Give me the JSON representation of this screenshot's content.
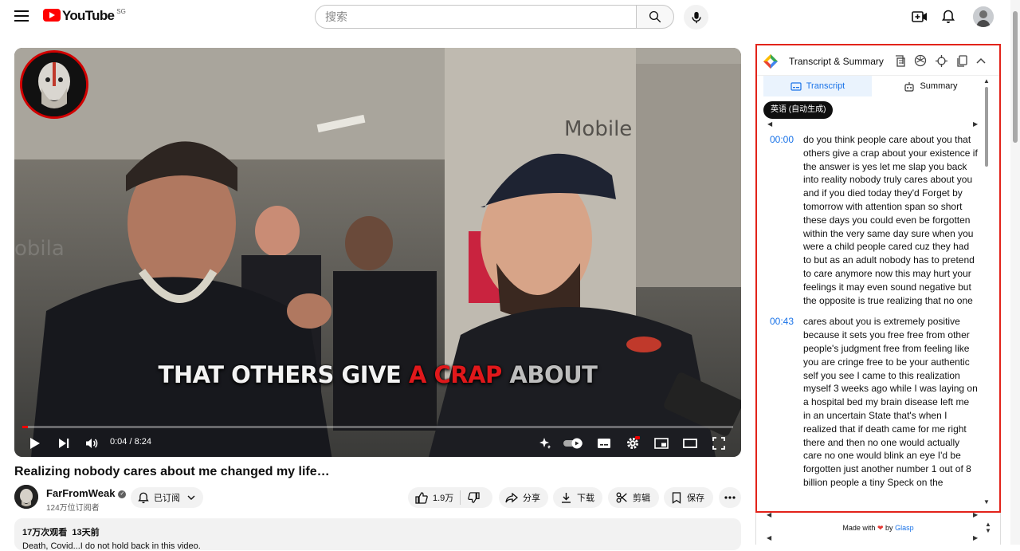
{
  "masthead": {
    "logo_text": "YouTube",
    "region": "SG",
    "search_placeholder": "搜索"
  },
  "player": {
    "caption": {
      "part1": "THAT OTHERS GIVE ",
      "part2": "A CRAP",
      "part3": " ABOUT"
    },
    "time": "0:04 / 8:24",
    "progress": 0.008
  },
  "video": {
    "title": "Realizing nobody cares about me changed my life…",
    "channel": "FarFromWeak",
    "subscribers": "124万位订阅者",
    "subscribe_label": "已订阅",
    "like_count": "1.9万",
    "share_label": "分享",
    "download_label": "下载",
    "clip_label": "剪辑",
    "save_label": "保存",
    "views": "17万次观看",
    "date": "13天前",
    "description": "Death, Covid...I do not hold back in this video."
  },
  "glasp": {
    "title": "Transcript & Summary",
    "tabs": [
      "Transcript",
      "Summary"
    ],
    "language": "英语 (自动生成)",
    "segments": [
      {
        "time": "00:00",
        "text": "do you think people care about you that others give a crap about your existence if the answer is yes let me slap you back into reality nobody truly cares about you and if you died today they'd Forget by tomorrow with attention span so short these days you could even be forgotten within the very same day sure when you were a child people cared cuz they had to but as an adult nobody has to pretend to care anymore now this may hurt your feelings it may even sound negative but the opposite is true realizing that no one"
      },
      {
        "time": "00:43",
        "text": "cares about you is extremely positive because it sets you free free from other people's judgment free from feeling like you are cringe free to be your authentic self you see I came to this realization myself 3 weeks ago while I was laying on a hospital bed my brain disease left me in an uncertain State that's when I realized that if death came for me right there and then no one would actually care no one would blink an eye I'd be forgotten just another number 1 out of 8 billion people a tiny Speck on the"
      }
    ],
    "footer": {
      "made_with": "Made with",
      "by": "by",
      "brand": "Glasp"
    }
  },
  "colors": {
    "brand_red": "#ff0000",
    "glasp_border": "#e2231a",
    "link_blue": "#1a73e8"
  }
}
